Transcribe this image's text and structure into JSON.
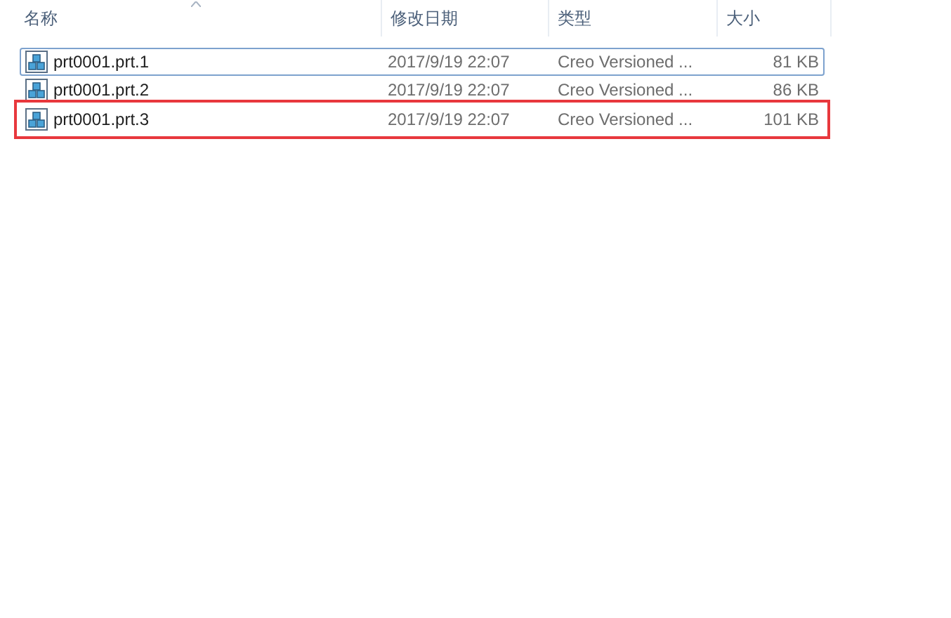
{
  "columns": [
    {
      "label": "名称",
      "sorted": true
    },
    {
      "label": "修改日期",
      "sorted": false
    },
    {
      "label": "类型",
      "sorted": false
    },
    {
      "label": "大小",
      "sorted": false
    }
  ],
  "rows": [
    {
      "name": "prt0001.prt.1",
      "modified": "2017/9/19 22:07",
      "type": "Creo Versioned ...",
      "size": "81 KB",
      "focused": true,
      "highlighted": false
    },
    {
      "name": "prt0001.prt.2",
      "modified": "2017/9/19 22:07",
      "type": "Creo Versioned ...",
      "size": "86 KB",
      "focused": false,
      "highlighted": false
    },
    {
      "name": "prt0001.prt.3",
      "modified": "2017/9/19 22:07",
      "type": "Creo Versioned ...",
      "size": "101 KB",
      "focused": false,
      "highlighted": true
    }
  ]
}
